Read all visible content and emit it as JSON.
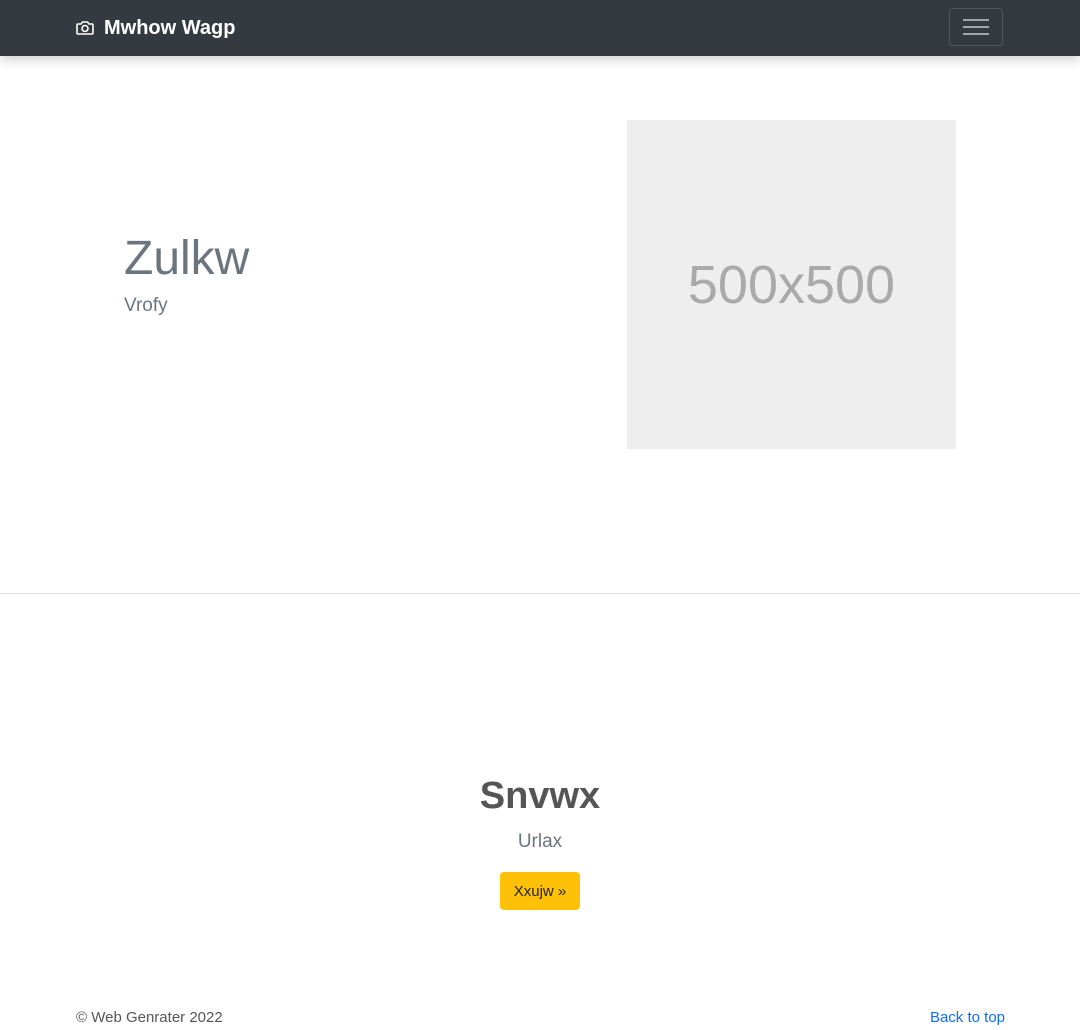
{
  "navbar": {
    "brand": "Mwhow Wagp",
    "brand_icon": "camera-icon",
    "toggle_icon": "hamburger-menu-icon",
    "background": "#343a40"
  },
  "hero": {
    "title": "Zulkw",
    "subtitle": "Vrofy",
    "image_placeholder": "500x500"
  },
  "cta": {
    "title": "Snvwx",
    "subtitle": "Urlax",
    "button_label": "Xxujw »",
    "button_color": "#ffc107"
  },
  "footer": {
    "copyright": "© Web Genrater 2022",
    "back_to_top": "Back to top",
    "link_color": "#0d6efd"
  }
}
